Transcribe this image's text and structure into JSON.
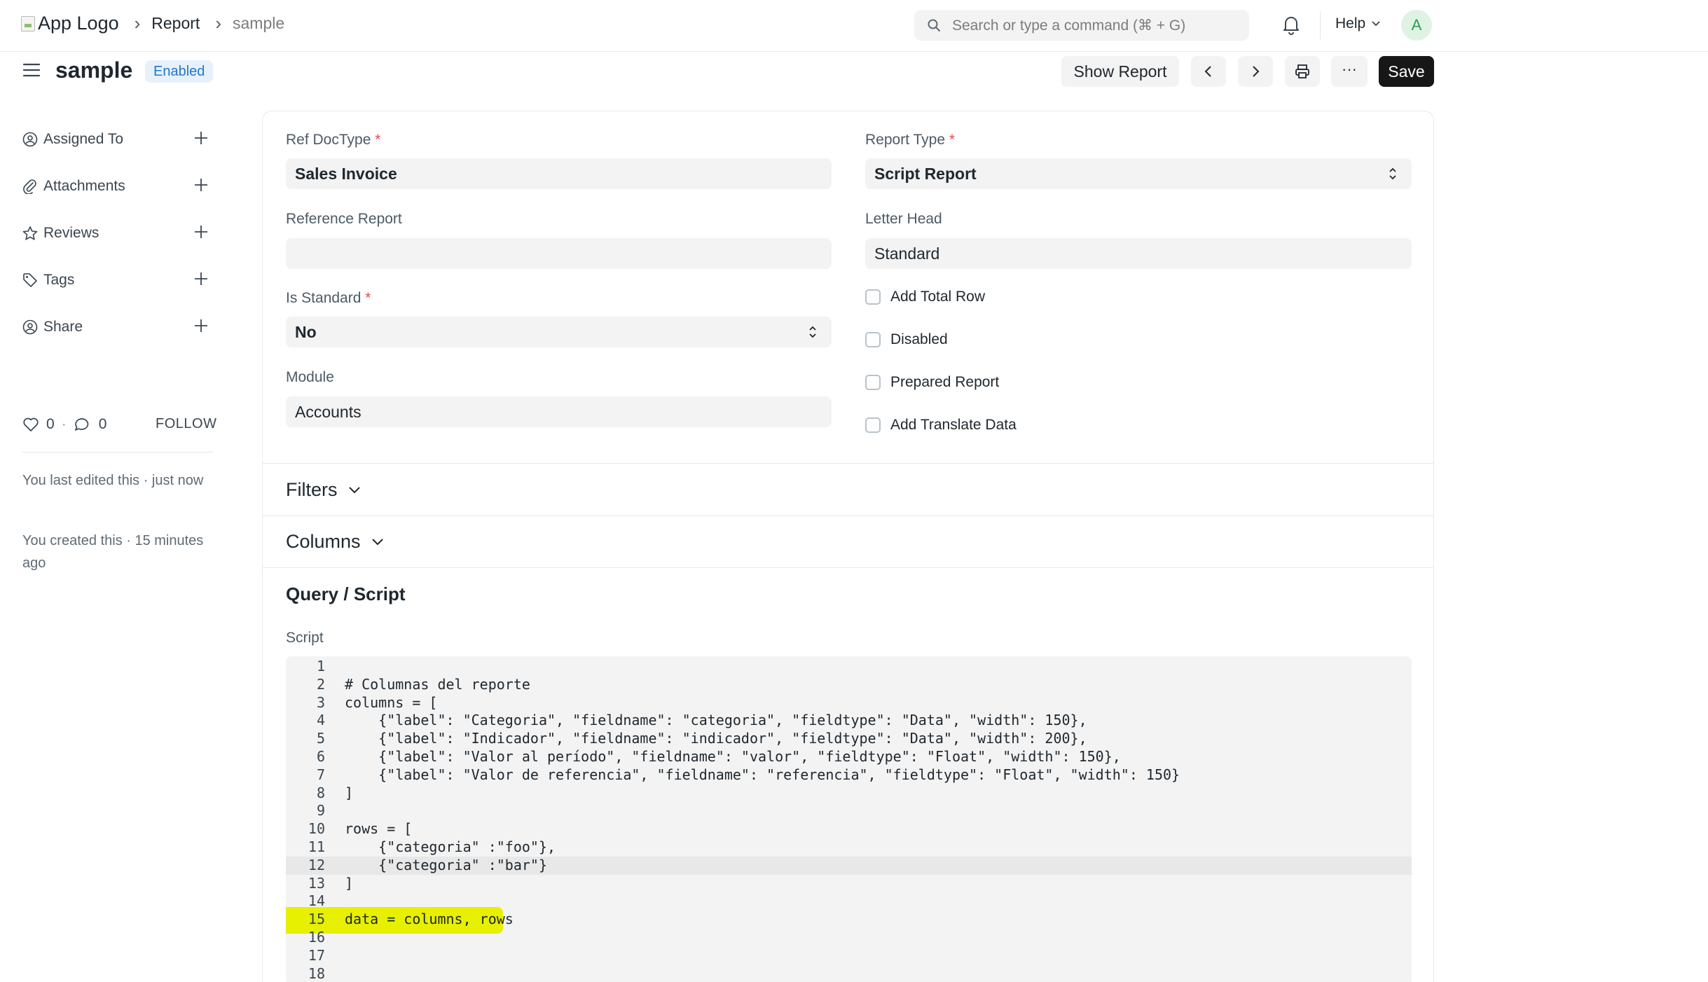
{
  "navbar": {
    "logo_alt": "App Logo",
    "breadcrumbs": [
      "Report",
      "sample"
    ],
    "search_placeholder": "Search or type a command (⌘ + G)",
    "help_label": "Help",
    "avatar_initial": "A"
  },
  "page": {
    "title": "sample",
    "status": "Enabled",
    "show_report_label": "Show Report",
    "save_label": "Save",
    "more_label": "···"
  },
  "sidebar": {
    "items": [
      {
        "label": "Assigned To",
        "icon": "assign-icon"
      },
      {
        "label": "Attachments",
        "icon": "paperclip-icon"
      },
      {
        "label": "Reviews",
        "icon": "star-icon"
      },
      {
        "label": "Tags",
        "icon": "tag-icon"
      },
      {
        "label": "Share",
        "icon": "share-icon"
      }
    ],
    "likes": "0",
    "comments": "0",
    "follow_label": "FOLLOW",
    "last_edited": "You last edited this · just now",
    "created": "You created this · 15 minutes ago"
  },
  "form": {
    "ref_doctype": {
      "label": "Ref DocType",
      "value": "Sales Invoice",
      "required": "*"
    },
    "reference_report": {
      "label": "Reference Report",
      "value": ""
    },
    "is_standard": {
      "label": "Is Standard",
      "value": "No",
      "required": "*"
    },
    "module": {
      "label": "Module",
      "value": "Accounts"
    },
    "report_type": {
      "label": "Report Type",
      "value": "Script Report",
      "required": "*"
    },
    "letter_head": {
      "label": "Letter Head",
      "value": "Standard"
    },
    "checkboxes": [
      {
        "label": "Add Total Row",
        "checked": false
      },
      {
        "label": "Disabled",
        "checked": false
      },
      {
        "label": "Prepared Report",
        "checked": false
      },
      {
        "label": "Add Translate Data",
        "checked": false
      }
    ]
  },
  "sections": {
    "filters": "Filters",
    "columns": "Columns",
    "query_script": "Query / Script",
    "script_label": "Script"
  },
  "script_lines": [
    "",
    "# Columnas del reporte",
    "columns = [",
    "    {\"label\": \"Categoria\", \"fieldname\": \"categoria\", \"fieldtype\": \"Data\", \"width\": 150},",
    "    {\"label\": \"Indicador\", \"fieldname\": \"indicador\", \"fieldtype\": \"Data\", \"width\": 200},",
    "    {\"label\": \"Valor al período\", \"fieldname\": \"valor\", \"fieldtype\": \"Float\", \"width\": 150},",
    "    {\"label\": \"Valor de referencia\", \"fieldname\": \"referencia\", \"fieldtype\": \"Float\", \"width\": 150}",
    "]",
    "",
    "rows = [",
    "    {\"categoria\" :\"foo\"},",
    "    {\"categoria\" :\"bar\"}",
    "]",
    "",
    "data = columns, rows",
    "",
    "",
    ""
  ],
  "colors": {
    "accent": "#171717",
    "badge_bg": "#e6f1fb",
    "badge_text": "#2477c8",
    "required": "#e24c4c",
    "highlight": "#e6f000"
  }
}
